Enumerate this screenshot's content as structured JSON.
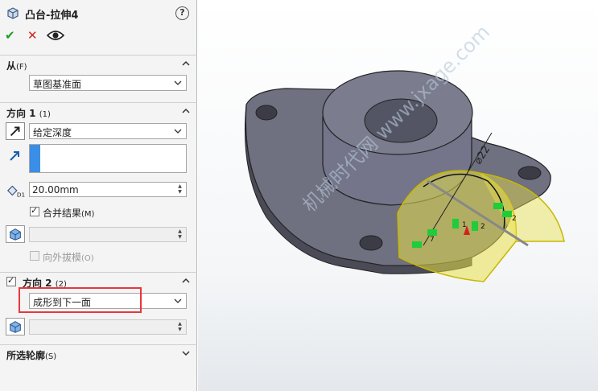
{
  "feature": {
    "title": "凸台-拉伸4",
    "help_symbol": "?"
  },
  "actions": {
    "ok_symbol": "✔",
    "cancel_symbol": "✕"
  },
  "from": {
    "title": "从",
    "shortcut": "(F)",
    "start_condition": "草图基准面"
  },
  "direction1": {
    "title": "方向 1",
    "shortcut": "(1)",
    "end_condition": "给定深度",
    "depth": "20.00mm",
    "merge_result_label": "合并结果",
    "merge_result_shortcut": "(M)",
    "draft_outward_label": "向外拔模",
    "draft_outward_shortcut": "(O)"
  },
  "direction2": {
    "title": "方向 2",
    "shortcut": "(2)",
    "end_condition": "成形到下一面"
  },
  "selected_contours": {
    "title": "所选轮廓",
    "shortcut": "(S)"
  },
  "viewport": {
    "dimension_label": "⌀22",
    "watermark": "机械时代网 www.jxage.com",
    "marker_labels": [
      "7",
      "2",
      "1",
      "2"
    ]
  },
  "colors": {
    "highlight": "#e8363d",
    "accent_blue": "#3a8ee6",
    "part_gray": "#6f7080",
    "preview_yellow": "#e8e04a",
    "relation_green": "#1fcc3a"
  }
}
